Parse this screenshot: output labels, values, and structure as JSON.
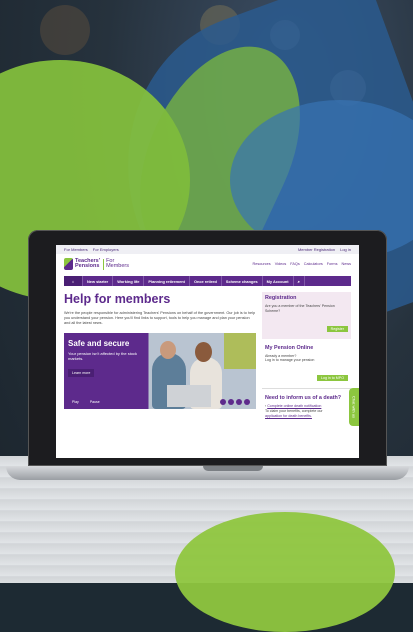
{
  "topbar": {
    "for_members": "For Members",
    "for_employers": "For Employers",
    "member_registration": "Member Registration",
    "log_in": "Log in"
  },
  "header": {
    "logo_line1": "Teachers'",
    "logo_line2": "Pensions",
    "logo_for": "For",
    "logo_members": "Members",
    "util_nav": [
      "Resources",
      "Videos",
      "FAQs",
      "Calculators",
      "Forms",
      "News"
    ]
  },
  "nav": {
    "items": [
      "New starter",
      "Working life",
      "Planning retirement",
      "Once retired",
      "Scheme changes",
      "My Account"
    ]
  },
  "main": {
    "title": "Help for members",
    "intro": "We're the people responsible for administering Teachers' Pensions on behalf of the government. Our job is to help you understand your pension. Here you'll find links to support, tools to help you manage and plan your pension and all the latest news.",
    "hero": {
      "title": "Safe and secure",
      "text": "Your pension isn't affected by the stock markets.",
      "learn_more": "Learn more",
      "pill1": "Play",
      "pill2": "Pause"
    }
  },
  "sidebar": {
    "registration": {
      "title": "Registration",
      "text": "Are you a member of the Teachers' Pension Scheme?",
      "button": "Register"
    },
    "online": {
      "title": "My Pension Online",
      "text1": "Already a member?",
      "text2": "Log in to manage your pension",
      "button": "Log in to MPO"
    },
    "inform": {
      "title": "Need to inform us of a death?",
      "item1": "Complete online death notification",
      "item2": "To claim your benefits, complete our",
      "link": "application for death benefits."
    }
  },
  "chat": {
    "label": "Chat with us"
  },
  "colors": {
    "purple": "#5d2a8c",
    "green": "#8cc63f"
  }
}
